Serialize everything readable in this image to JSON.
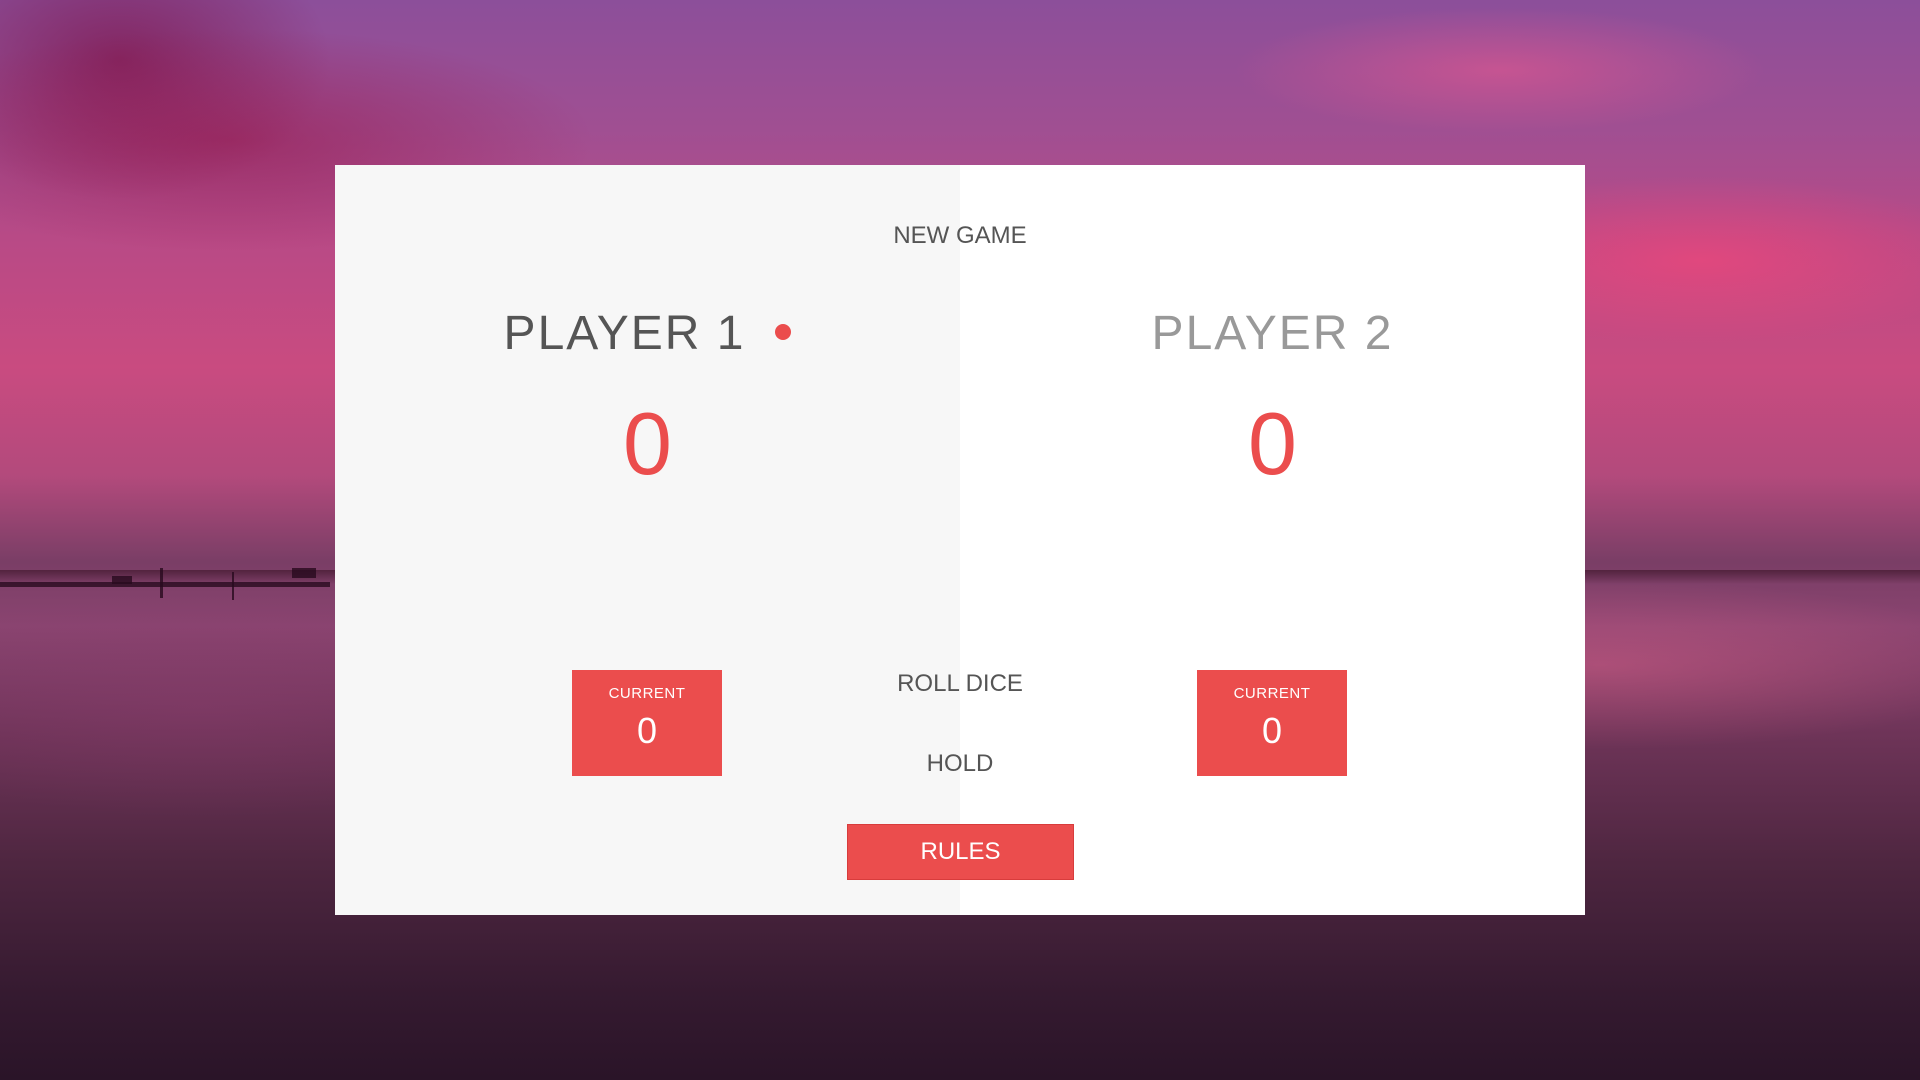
{
  "game": {
    "new_game_label": "NEW GAME",
    "roll_dice_label": "ROLL DICE",
    "hold_label": "HOLD",
    "rules_label": "RULES"
  },
  "players": [
    {
      "name": "PLAYER 1",
      "score": "0",
      "current_label": "CURRENT",
      "current_score": "0",
      "active": true
    },
    {
      "name": "PLAYER 2",
      "score": "0",
      "current_label": "CURRENT",
      "current_score": "0",
      "active": false
    }
  ],
  "colors": {
    "accent": "#eb4d4d",
    "panel_active": "#f7f7f7",
    "panel_inactive": "#ffffff",
    "text_dark": "#555555",
    "text_light": "#999999"
  }
}
